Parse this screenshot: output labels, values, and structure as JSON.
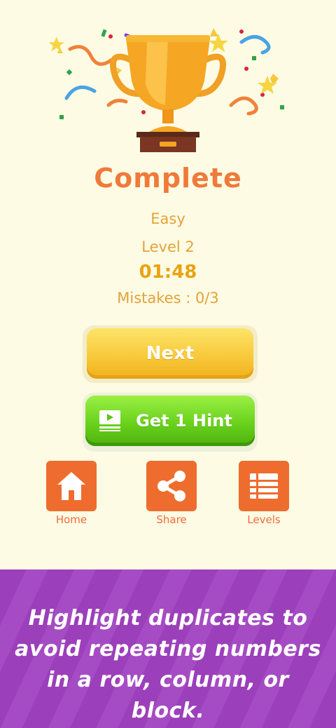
{
  "result": {
    "title": "Complete",
    "difficulty": "Easy",
    "level": "Level 2",
    "time": "01:48",
    "mistakes": "Mistakes : 0/3"
  },
  "buttons": {
    "next": "Next",
    "hint": "Get 1 Hint"
  },
  "nav": {
    "home": "Home",
    "share": "Share",
    "levels": "Levels"
  },
  "banner": {
    "text": "Highlight duplicates to avoid repeating numbers in a row, column, or block."
  },
  "icons": [
    "trophy-icon",
    "video-icon",
    "home-icon",
    "share-icon",
    "list-icon"
  ],
  "colors": {
    "accent_orange": "#ee6d2e",
    "next_yellow": "#f8c737",
    "hint_green": "#66cf1a",
    "banner_purple": "#9b3fba"
  }
}
